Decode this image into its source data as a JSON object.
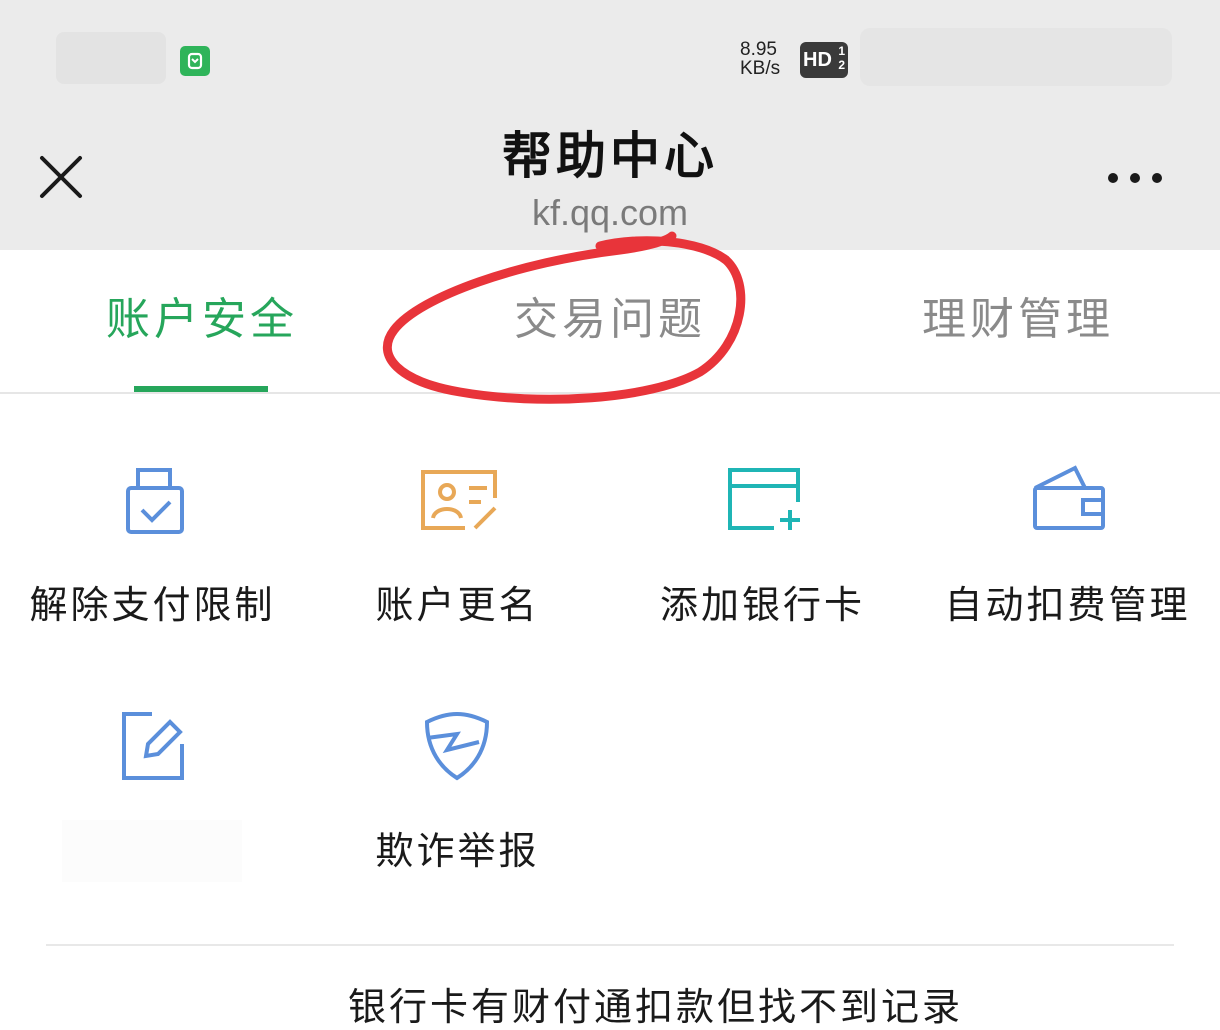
{
  "status_bar": {
    "net_speed_value": "8.95",
    "net_speed_unit": "KB/s",
    "hd_label": "HD",
    "hd_sub_top": "1",
    "hd_sub_bottom": "2"
  },
  "header": {
    "title": "帮助中心",
    "domain": "kf.qq.com",
    "close_icon": "close-icon",
    "more_icon": "more-dots-icon"
  },
  "tabs": [
    {
      "label": "账户安全",
      "active": true
    },
    {
      "label": "交易问题",
      "active": false
    },
    {
      "label": "理财管理",
      "active": false
    }
  ],
  "grid": [
    {
      "label": "解除支付限制",
      "icon": "lock-check-icon",
      "color": "#5b8fdb"
    },
    {
      "label": "账户更名",
      "icon": "id-card-edit-icon",
      "color": "#e8a857"
    },
    {
      "label": "添加银行卡",
      "icon": "card-add-icon",
      "color": "#1fb5b5"
    },
    {
      "label": "自动扣费管理",
      "icon": "wallet-icon",
      "color": "#5b8fdb"
    },
    {
      "label": "",
      "icon": "note-edit-icon",
      "color": "#5b8fdb"
    },
    {
      "label": "欺诈举报",
      "icon": "shield-icon",
      "color": "#5b8fdb"
    }
  ],
  "faq": {
    "first_item": "银行卡有财付通扣款但找不到记录"
  },
  "colors": {
    "accent": "#26a65b",
    "annotation": "#e8343a",
    "header_bg": "#ebebeb"
  }
}
